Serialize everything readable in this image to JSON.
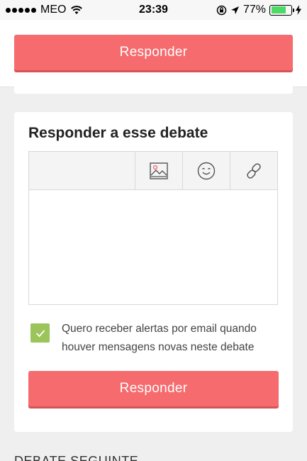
{
  "status_bar": {
    "carrier": "MEO",
    "time": "23:39",
    "battery_percent": "77%",
    "battery_level": 0.77,
    "icons": [
      "signal-dots-icon",
      "wifi-icon",
      "rotation-lock-icon",
      "location-arrow-icon",
      "battery-icon",
      "charging-bolt-icon"
    ]
  },
  "top": {
    "reply_button_label": "Responder"
  },
  "reply_card": {
    "title": "Responder a esse debate",
    "toolbar_icons": [
      "image-icon",
      "emoji-icon",
      "link-icon"
    ],
    "textarea_value": "",
    "alert_checkbox_checked": true,
    "alert_text": "Quero receber alertas por email quando houver mensagens novas neste debate",
    "submit_label": "Responder"
  },
  "next_section": {
    "label": "DEBATE SEGUINTE"
  },
  "colors": {
    "accent": "#f56b6e",
    "accent_shadow": "#d65357",
    "checkbox": "#9bc45b",
    "background": "#efefef"
  }
}
